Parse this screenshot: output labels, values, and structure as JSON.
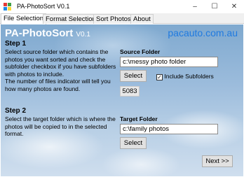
{
  "window": {
    "title": "PA-PhotoSort V0.1",
    "minimize_glyph": "–",
    "maximize_glyph": "☐",
    "close_glyph": "✕"
  },
  "tabs": [
    {
      "label": "File Selection",
      "active": true
    },
    {
      "label": "Format Selection",
      "active": false
    },
    {
      "label": "Sort Photos",
      "active": false
    },
    {
      "label": "About",
      "active": false
    }
  ],
  "header": {
    "app_name": "PA-PhotoSort",
    "version": "V0.1",
    "website": "pacauto.com.au"
  },
  "step1": {
    "heading": "Step 1",
    "description": [
      "Select source folder which contains the",
      "photos you want sorted and check the",
      "subfolder checkbox if you have subfolders",
      "with photos to include.",
      "The number of files indicator will tell you",
      "how many photos are found."
    ],
    "source_label": "Source Folder",
    "source_value": "c:\\messy photo folder",
    "select_label": "Select",
    "include_subfolders_label": "Include Subfolders",
    "include_subfolders_checked": true,
    "file_count": "5083"
  },
  "step2": {
    "heading": "Step 2",
    "description": [
      "Select the target folder which is where the",
      "photos will be copied to in the selected",
      "format."
    ],
    "target_label": "Target Folder",
    "target_value": "c:\\family photos",
    "select_label": "Select"
  },
  "next_label": "Next >>",
  "colors": {
    "website": "#1f7ae0",
    "title_text": "#ffffff"
  }
}
